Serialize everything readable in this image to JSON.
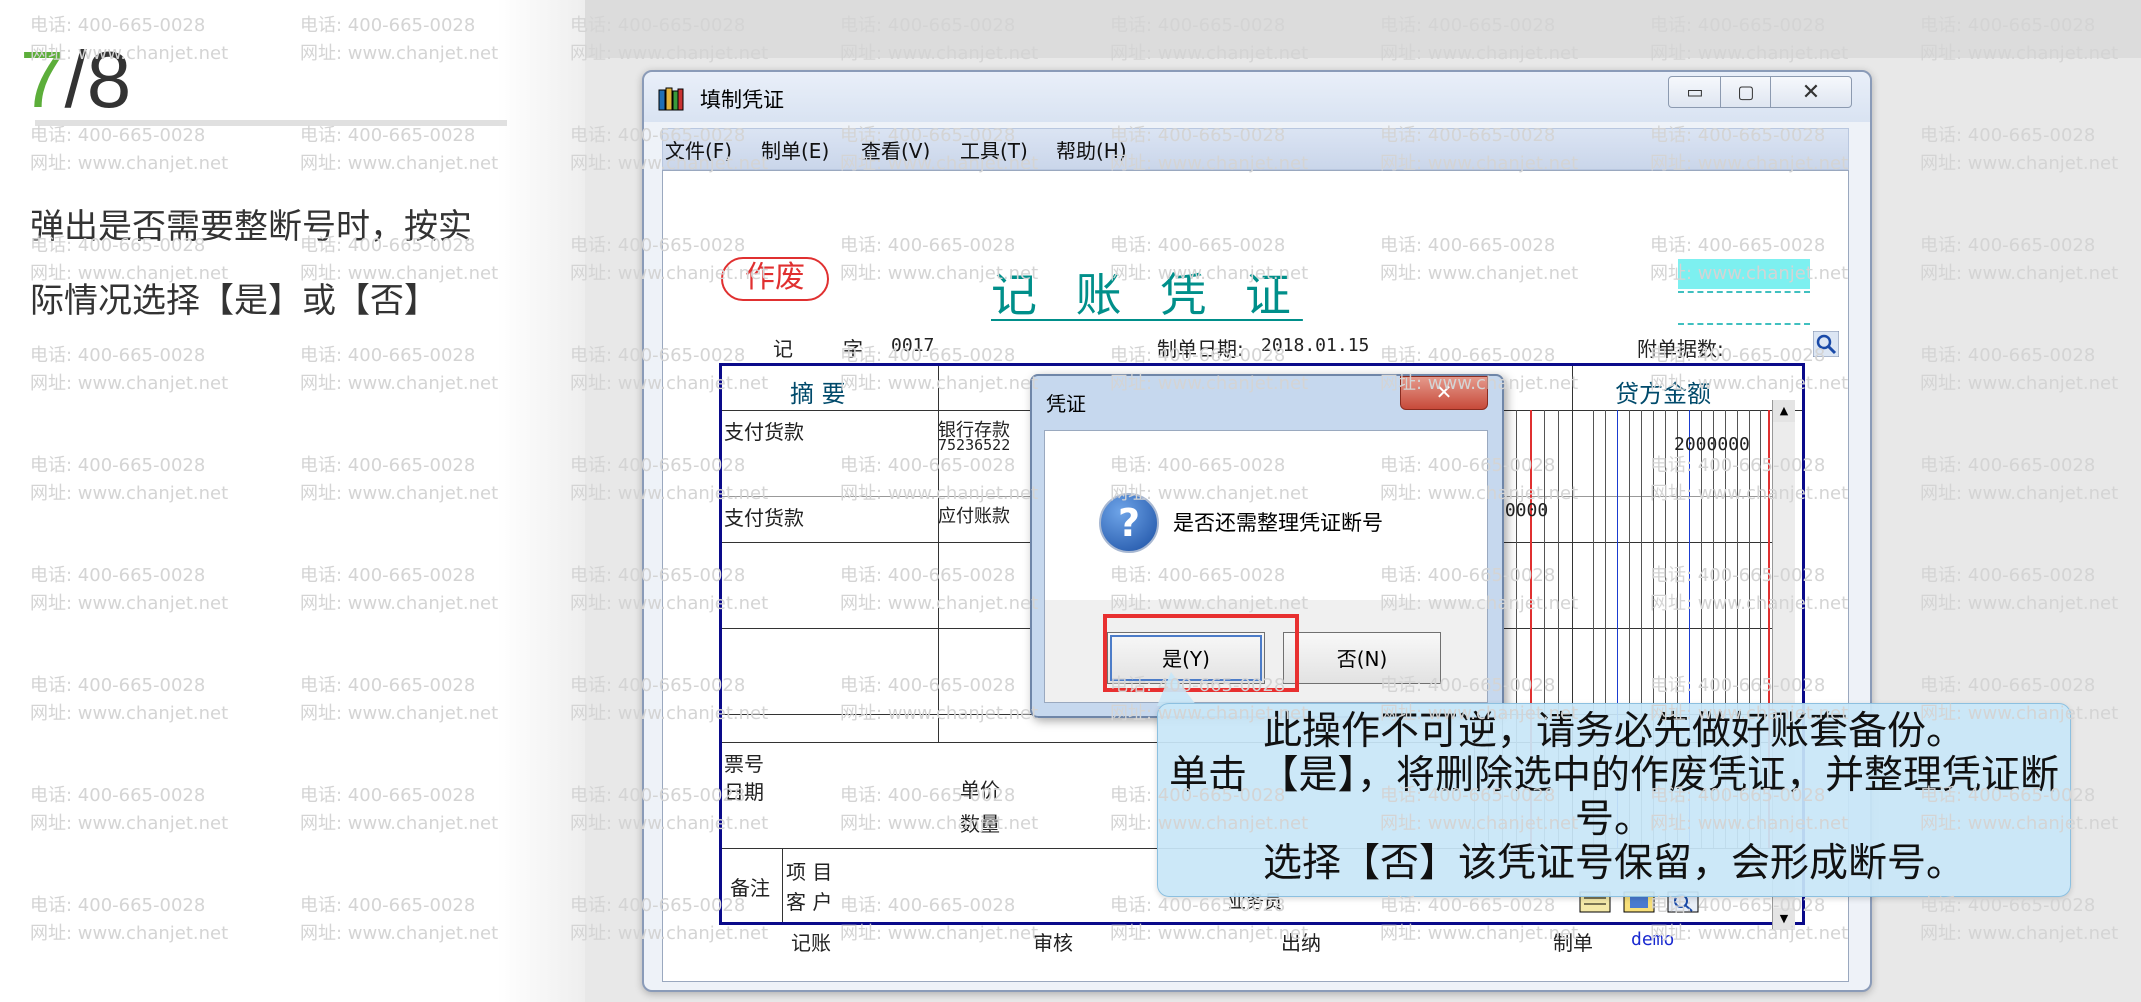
{
  "step": {
    "current": "7",
    "total": "/8"
  },
  "instruction": "弹出是否需要整断号时，按实际情况选择【是】或【否】",
  "watermark": {
    "phone": "电话: 400-665-0028",
    "site": "网址: www.chanjet.net"
  },
  "window": {
    "title": "填制凭证",
    "min": "▭",
    "max": "▢",
    "close": "✕",
    "menu": [
      "文件(F)",
      "制单(E)",
      "查看(V)",
      "工具(T)",
      "帮助(H)"
    ]
  },
  "voucher": {
    "void_stamp": "作废",
    "title": "记 账 凭 证",
    "type_label": "记",
    "number_label": "字",
    "number": "0017",
    "date_label": "制单日期:",
    "date": "2018.01.15",
    "attachments_label": "附单据数:",
    "col_summary": "摘 要",
    "col_credit": "贷方金额",
    "rows": [
      {
        "summary": "支付货款",
        "account": "银行存款",
        "account_sub": "75236522",
        "credit": "2000000",
        "debit": ""
      },
      {
        "summary": "支付货款",
        "account": "应付账款",
        "account_sub": "",
        "credit": "",
        "debit": "00000"
      }
    ],
    "ticket_no": "票号",
    "ticket_date": "日期",
    "unit_price": "单价",
    "quantity": "数量",
    "remark": "备注",
    "project": "项 目",
    "customer": "客 户",
    "salesperson": "业务员",
    "bookkeeper": "记账",
    "auditor": "审核",
    "cashier": "出纳",
    "maker_label": "制单",
    "maker": "demo"
  },
  "dialog": {
    "title": "凭证",
    "message": "是否还需整理凭证断号",
    "yes": "是(Y)",
    "no": "否(N)",
    "close": "✕"
  },
  "callout": {
    "line1": "此操作不可逆，请务必先做好账套备份。",
    "line2": "单击 【是】，将删除选中的作废凭证，并整理凭证断号。",
    "line3": "选择【否】该凭证号保留，会形成断号。"
  }
}
